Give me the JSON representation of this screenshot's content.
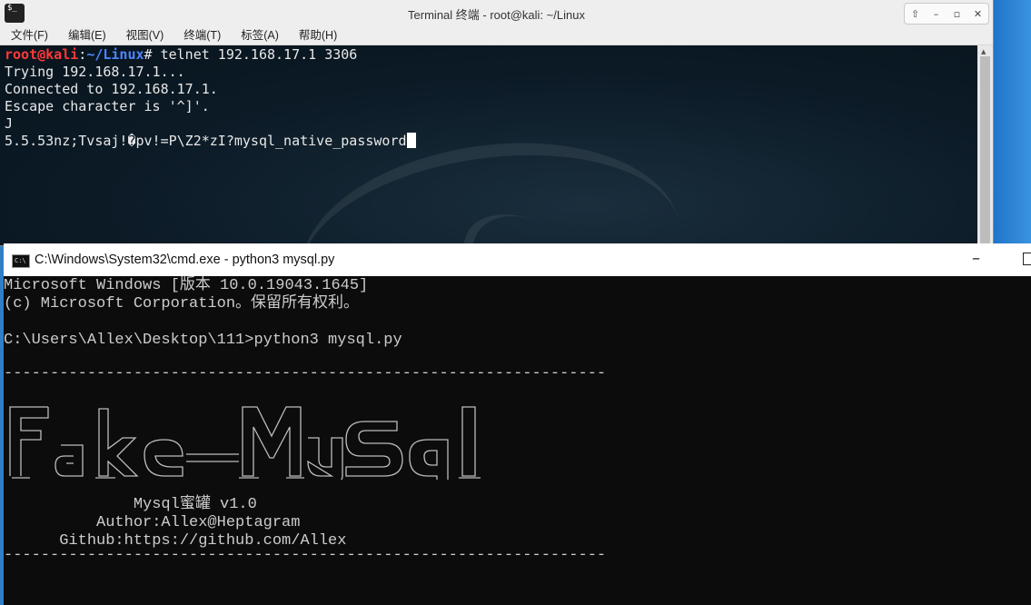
{
  "terminal": {
    "title": "Terminal 终端 - root@kali: ~/Linux",
    "menu": [
      "文件(F)",
      "编辑(E)",
      "视图(V)",
      "终端(T)",
      "标签(A)",
      "帮助(H)"
    ],
    "prompt_user": "root@kali",
    "prompt_sep": ":",
    "prompt_path": "~/Linux",
    "prompt_hash": "#",
    "command": " telnet 192.168.17.1 3306",
    "output": [
      "Trying 192.168.17.1...",
      "Connected to 192.168.17.1.",
      "Escape character is '^]'.",
      "J",
      "5.5.53nz;Tvsaj!�pv!=P\\Z2*zI?mysql_native_password"
    ]
  },
  "cmd": {
    "title": "C:\\Windows\\System32\\cmd.exe - python3  mysql.py",
    "lines": [
      "Microsoft Windows [版本 10.0.19043.1645]",
      "(c) Microsoft Corporation。保留所有权利。",
      "",
      "C:\\Users\\Allex\\Desktop\\111>python3 mysql.py",
      "",
      "-----------------------------------------------------------------"
    ],
    "banner": "Fake-MySql",
    "info": [
      "              Mysql蜜罐 v1.0",
      "          Author:Allex@Heptagram",
      "      Github:https://github.com/Allex",
      "-----------------------------------------------------------------"
    ]
  }
}
